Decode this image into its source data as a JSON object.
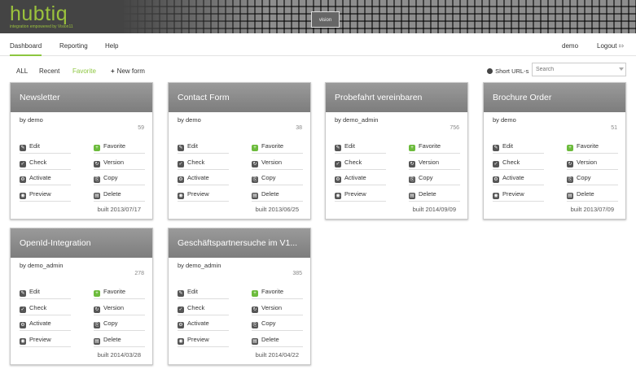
{
  "app": {
    "logo": "hubtiq",
    "tagline": "integration empowered by Vision11",
    "badge": "vision"
  },
  "nav": {
    "tabs": [
      {
        "label": "Dashboard",
        "active": true
      },
      {
        "label": "Reporting",
        "active": false
      },
      {
        "label": "Help",
        "active": false
      }
    ],
    "user": "demo",
    "logout": "Logout"
  },
  "toolbar": {
    "filters": [
      {
        "label": "ALL",
        "active": false
      },
      {
        "label": "Recent",
        "active": false
      },
      {
        "label": "Favorite",
        "active": true
      }
    ],
    "new_form": "New form",
    "short_urls": "Short URL-s",
    "search_placeholder": "Search"
  },
  "colors": {
    "accent": "#8cc63f",
    "card_header": "#8a8a8a",
    "favorite_icon": "#6cbb3c"
  },
  "action_labels": {
    "edit": "Edit",
    "check": "Check",
    "activate": "Activate",
    "preview": "Preview",
    "favorite": "Favorite",
    "version": "Version",
    "copy": "Copy",
    "delete": "Delete"
  },
  "cards": [
    {
      "title": "Newsletter",
      "by": "by demo",
      "count": "59",
      "built": "built 2013/07/17"
    },
    {
      "title": "Contact Form",
      "by": "by demo",
      "count": "38",
      "built": "built 2013/06/25"
    },
    {
      "title": "Probefahrt vereinbaren",
      "by": "by demo_admin",
      "count": "756",
      "built": "built 2014/09/09"
    },
    {
      "title": "Brochure Order",
      "by": "by demo",
      "count": "51",
      "built": "built 2013/07/09"
    },
    {
      "title": "OpenId-Integration",
      "by": "by demo_admin",
      "count": "278",
      "built": "built 2014/03/28"
    },
    {
      "title": "Geschäftspartnersuche im V1...",
      "by": "by demo_admin",
      "count": "385",
      "built": "built 2014/04/22"
    }
  ]
}
